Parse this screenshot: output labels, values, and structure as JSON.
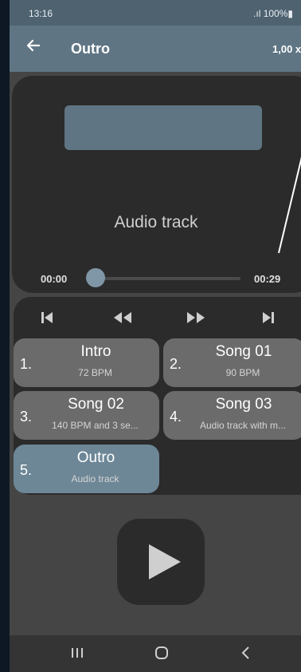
{
  "status_bar": {
    "time": "13:16",
    "battery": ".ıl 100%▮"
  },
  "toolbar": {
    "back_icon": "back-arrow-icon",
    "title": "Outro",
    "speed": "1,00 x"
  },
  "player": {
    "track_label": "Audio track",
    "time_current": "00:00",
    "time_total": "00:29",
    "progress": 0.0
  },
  "controls": {
    "icons": [
      "skip-previous-icon",
      "rewind-icon",
      "fast-forward-icon",
      "skip-next-icon"
    ]
  },
  "tracks": [
    {
      "number": "1.",
      "name": "Intro",
      "detail": "72 BPM",
      "active": false
    },
    {
      "number": "2.",
      "name": "Song 01",
      "detail": "90 BPM",
      "active": false
    },
    {
      "number": "3.",
      "name": "Song 02",
      "detail": "140 BPM and 3 se...",
      "active": false
    },
    {
      "number": "4.",
      "name": "Song 03",
      "detail": "Audio track with m...",
      "active": false
    },
    {
      "number": "5.",
      "name": "Outro",
      "detail": "Audio track",
      "active": true
    }
  ],
  "play_button": {
    "icon": "play-icon"
  },
  "navbar": {
    "icons": [
      "recent-apps-icon",
      "home-icon",
      "back-icon"
    ]
  },
  "colors": {
    "accent": "#5f7584",
    "card": "#2b2b2b",
    "background": "#454545"
  }
}
